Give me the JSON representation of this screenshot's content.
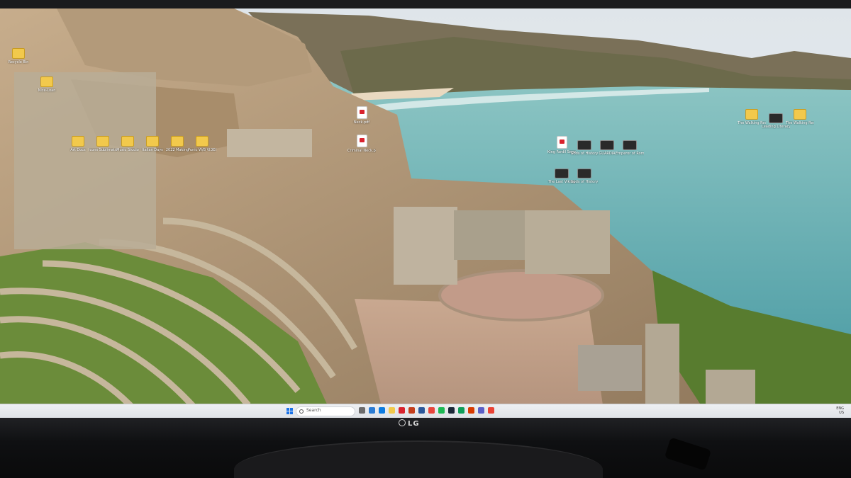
{
  "monitor": {
    "brand": "LG"
  },
  "desktop": {
    "left_icons": [
      {
        "label": "Recycle Bin",
        "type": "folder"
      },
      {
        "label": "Nice-Loan",
        "type": "folder"
      },
      {
        "label": "Art Docs",
        "type": "folder"
      },
      {
        "label": "Icons Sublimation",
        "type": "folder"
      },
      {
        "label": "Music Studio",
        "type": "folder"
      },
      {
        "label": "Italian Days",
        "type": "folder"
      },
      {
        "label": "2022 Making",
        "type": "folder"
      },
      {
        "label": "Punic W/B VIDEOS",
        "type": "folder"
      }
    ],
    "center_icons": [
      {
        "label": "Neck.pdf",
        "type": "pdf"
      },
      {
        "label": "Criminal Neck.pdf",
        "type": "pdf"
      },
      {
        "label": "King Fardil Sega Gems",
        "type": "pdf"
      },
      {
        "label": "Gods of History",
        "type": "video"
      },
      {
        "label": "GUARDIA",
        "type": "video"
      },
      {
        "label": "Emperor of Rome",
        "type": "video"
      },
      {
        "label": "The Last Viking",
        "type": "video"
      },
      {
        "label": "Gods of History",
        "type": "video"
      }
    ],
    "right_icons": [
      {
        "label": "The Walking Revolution - Worksheets",
        "type": "folder"
      },
      {
        "label": "Leading Literacy",
        "type": "video"
      },
      {
        "label": "The Walking Revolution",
        "type": "folder"
      }
    ]
  },
  "taskbar": {
    "search_placeholder": "Search",
    "tray_lang": "ENG",
    "tray_region": "US"
  },
  "colors": {
    "sea": "#6fb4b4",
    "cliff": "#a08a6e",
    "grass": "#5f8a2e",
    "stone": "#c9b79c"
  }
}
